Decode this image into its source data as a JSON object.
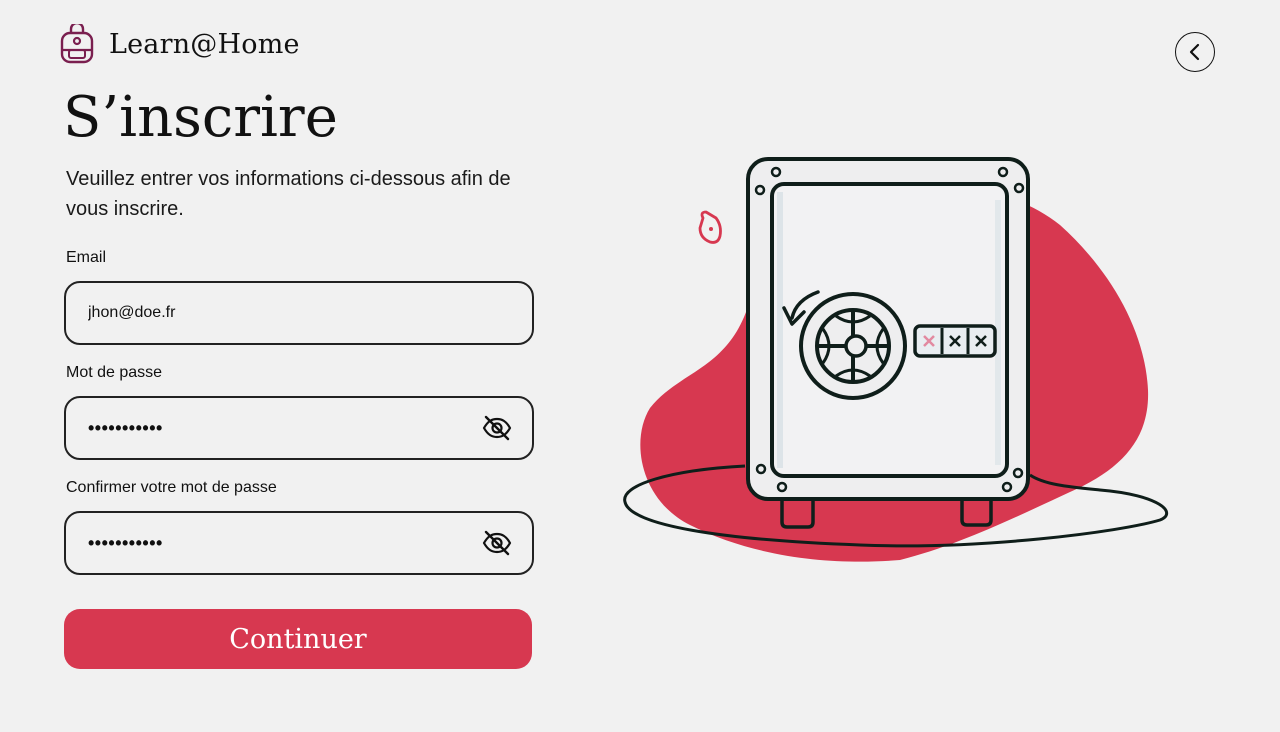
{
  "brand": {
    "name": "Learn@Home",
    "icon": "backpack-icon",
    "icon_color": "#7a1f4f"
  },
  "back_button": {
    "icon": "chevron-left-icon"
  },
  "page": {
    "title": "S’inscrire",
    "subtitle": "Veuillez entrer vos informations ci-dessous afin de vous inscrire."
  },
  "form": {
    "email": {
      "label": "Email",
      "value": "jhon@doe.fr"
    },
    "password": {
      "label": "Mot de passe",
      "value": "•••••••••••",
      "icon": "eye-off-icon"
    },
    "confirm_password": {
      "label": "Confirmer votre mot de passe",
      "value": "•••••••••••",
      "icon": "eye-off-icon"
    },
    "submit_label": "Continuer"
  },
  "illustration": {
    "icon": "safe-icon"
  },
  "colors": {
    "background": "#f1f1f1",
    "accent": "#d73850",
    "text": "#111111"
  }
}
